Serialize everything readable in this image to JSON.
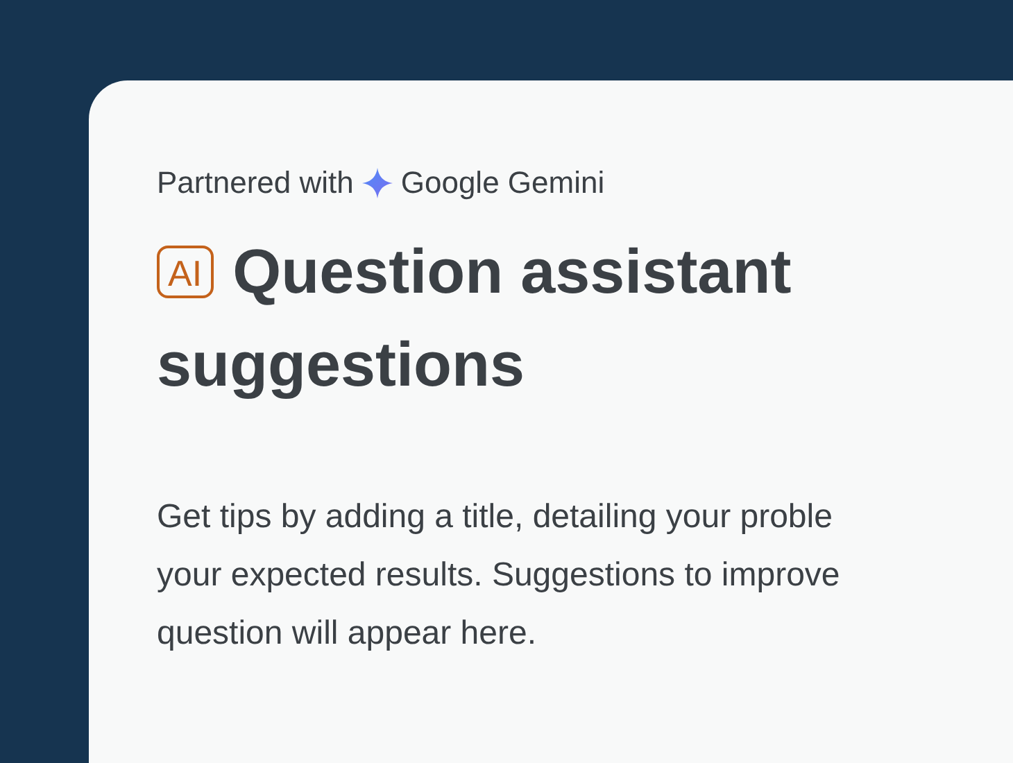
{
  "partner": {
    "prefix": "Partnered with",
    "brand": "Google Gemini"
  },
  "heading": {
    "badge": "AI",
    "title_lines": [
      "Question assistant",
      "suggestions"
    ]
  },
  "description_lines": [
    "Get tips by adding a title, detailing your proble",
    "your expected results. Suggestions to improve",
    "question will appear here."
  ]
}
